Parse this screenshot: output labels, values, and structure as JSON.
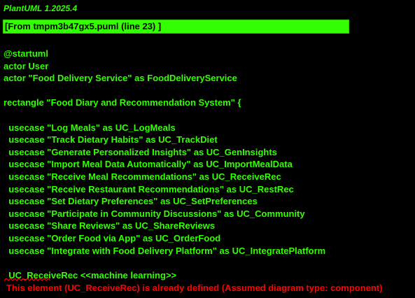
{
  "header": {
    "version": "PlantUML 1.2025.4",
    "source_ref": "[From tmpm3b47gx5.puml (line 23) ]"
  },
  "code_lines": [
    "@startuml",
    "actor User",
    "actor \"Food Delivery Service\" as FoodDeliveryService",
    "",
    "rectangle \"Food Diary and Recommendation System\" {",
    "",
    "  usecase \"Log Meals\" as UC_LogMeals",
    "  usecase \"Track Dietary Habits\" as UC_TrackDiet",
    "  usecase \"Generate Personalized Insights\" as UC_GenInsights",
    "  usecase \"Import Meal Data Automatically\" as UC_ImportMealData",
    "  usecase \"Receive Meal Recommendations\" as UC_ReceiveRec",
    "  usecase \"Receive Restaurant Recommendations\" as UC_RestRec",
    "  usecase \"Set Dietary Preferences\" as UC_SetPreferences",
    "  usecase \"Participate in Community Discussions\" as UC_Community",
    "  usecase \"Share Reviews\" as UC_ShareReviews",
    "  usecase \"Order Food via App\" as UC_OrderFood",
    "  usecase \"Integrate with Food Delivery Platform\" as UC_IntegratePlatform"
  ],
  "error": {
    "source_line": "  UC_ReceiveRec <<machine learning>>",
    "message": "This element (UC_ReceiveRec) is already defined (Assumed diagram type: component)"
  },
  "colors": {
    "background": "#000000",
    "text": "#33ff02",
    "error": "#ff0000"
  }
}
